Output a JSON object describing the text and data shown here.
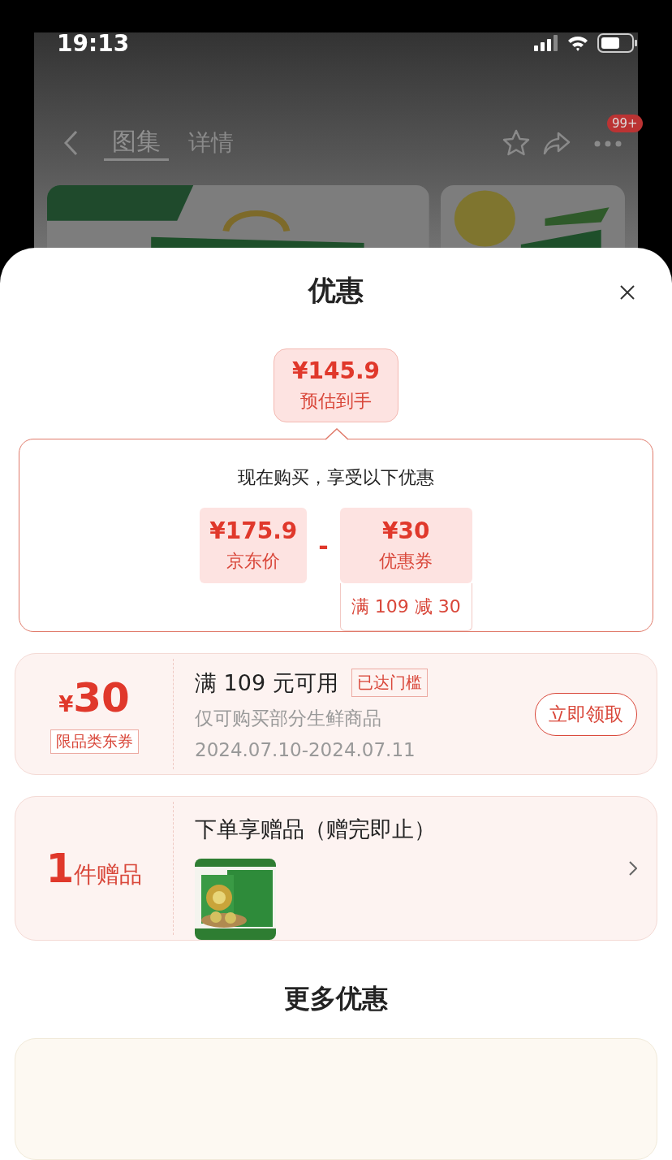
{
  "status_bar": {
    "time": "19:13"
  },
  "nav": {
    "tabs": [
      {
        "label": "图集",
        "selected": true
      },
      {
        "label": "详情",
        "selected": false
      }
    ],
    "badge": "99+"
  },
  "sheet": {
    "title": "优惠",
    "estimate": {
      "price": "¥145.9",
      "label": "预估到手"
    },
    "breakdown": {
      "heading": "现在购买，享受以下优惠",
      "operator": "-",
      "items": [
        {
          "price": "¥175.9",
          "label": "京东价"
        },
        {
          "price": "¥30",
          "label": "优惠券",
          "note": "满 109 减 30"
        }
      ]
    },
    "offers": [
      {
        "kind": "coupon",
        "currency": "¥",
        "amount": "30",
        "tag": "限品类东券",
        "title": "满 109 元可用",
        "badge": "已达门槛",
        "desc": "仅可购买部分生鲜商品",
        "dates": "2024.07.10-2024.07.11",
        "action": "立即领取"
      },
      {
        "kind": "gift",
        "count": "1",
        "unit": "件赠品",
        "title": "下单享赠品（赠完即止）"
      }
    ],
    "more_title": "更多优惠"
  }
}
